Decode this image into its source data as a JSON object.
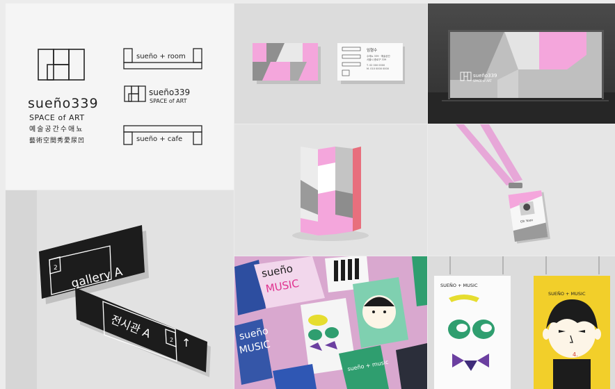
{
  "colors": {
    "pink": "#f4a6dc",
    "gray": "#9a9a9a",
    "light_gray": "#c8c8c8",
    "black": "#1f1f1f",
    "yellow": "#f2cf2a",
    "green": "#2f9e6f"
  },
  "logo": {
    "wordmark": "sueño339",
    "subtitle": "SPACE of ART",
    "korean": "예술공간수애뇨",
    "hanja": "藝術空間秀愛尿凹"
  },
  "sub_brands": {
    "room": "sueño + room",
    "main": "sueño339",
    "main_sub": "SPACE of ART",
    "cafe": "sueño + cafe"
  },
  "business_card": {
    "name": "임형수",
    "lines": [
      "수애뇨 339 · 예술공간",
      "서울시 종로구 339",
      "T. 02 000 0000",
      "M. 010 0000 0000"
    ]
  },
  "banner": {
    "wordmark": "sueño339",
    "sub": "SPACE of ART"
  },
  "id_card": {
    "name": "Oh Yoon"
  },
  "sign": {
    "number": "2",
    "label_en": "gallery A",
    "label_ko": "전시관 A"
  },
  "posters": {
    "music_title": "SUEÑO + MUSIC",
    "sueno": "sueño",
    "music": "MUSIC",
    "pink_top_a": "sueño",
    "pink_top_b": "MUSIC",
    "green_poster_label": "sueño + music",
    "yellow_number": "4.",
    "white_left_label": "SUEÑO + MUSIC"
  }
}
